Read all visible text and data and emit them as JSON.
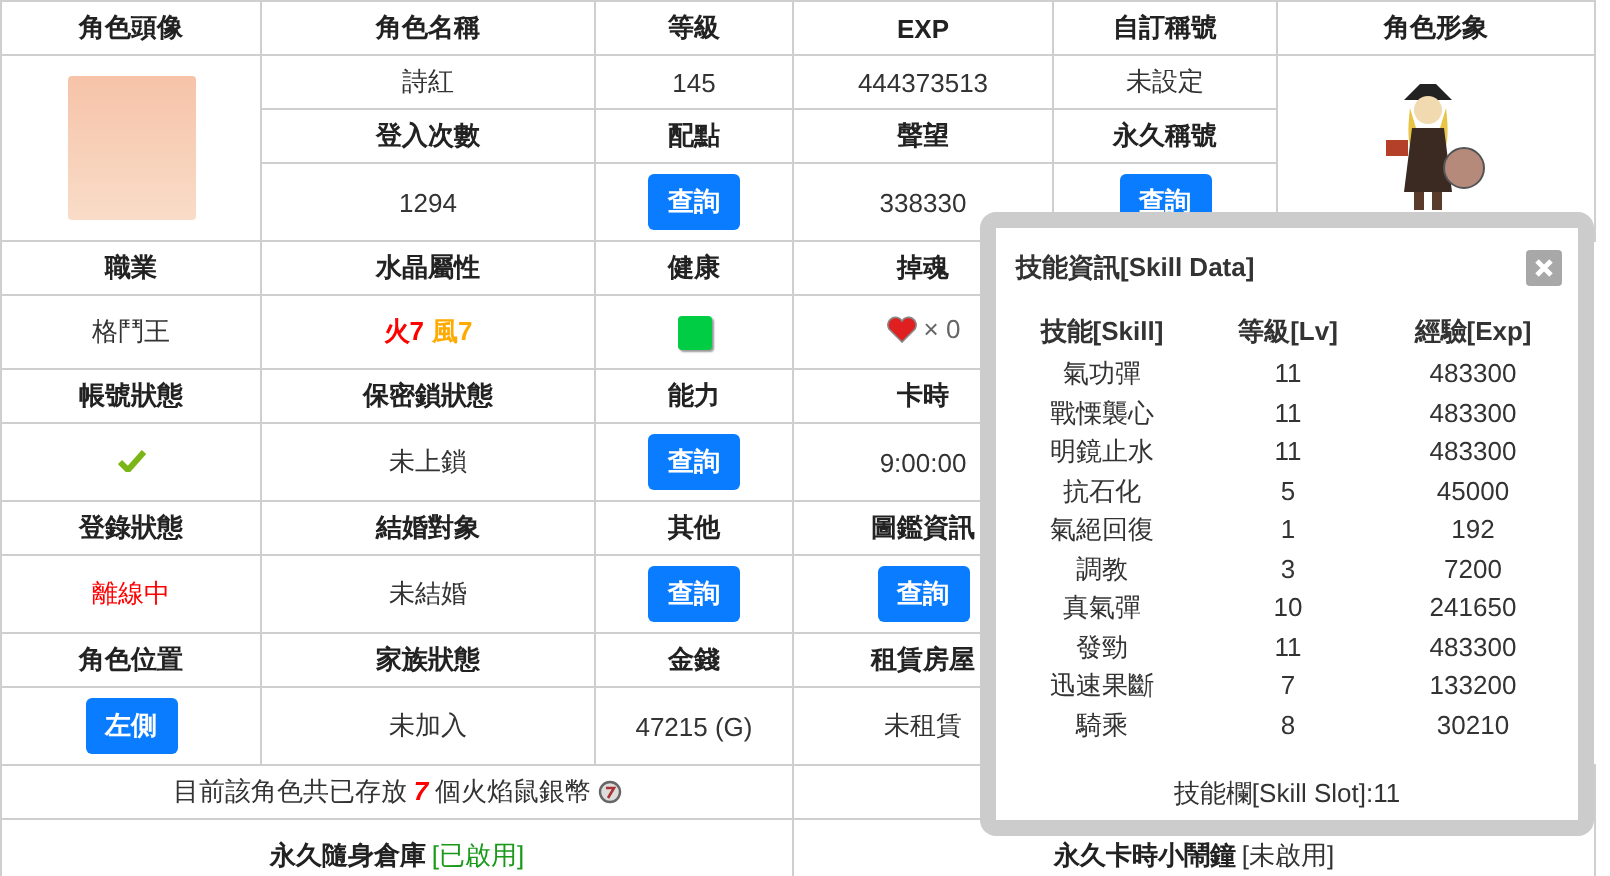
{
  "table": {
    "rows": [
      {
        "cells": [
          {
            "kind": "header",
            "text": "角色頭像"
          },
          {
            "kind": "header",
            "text": "角色名稱"
          },
          {
            "kind": "header",
            "text": "等級"
          },
          {
            "kind": "header",
            "text": "EXP"
          },
          {
            "kind": "header",
            "text": "自訂稱號"
          },
          {
            "kind": "header",
            "text": "角色形象"
          }
        ]
      },
      {
        "cells": [
          {
            "kind": "avatar"
          },
          {
            "kind": "text",
            "text": "詩紅"
          },
          {
            "kind": "text",
            "text": "145"
          },
          {
            "kind": "text",
            "text": "444373513"
          },
          {
            "kind": "text",
            "text": "未設定"
          },
          {
            "kind": "sprite"
          }
        ]
      },
      {
        "cells": [
          {
            "kind": "header",
            "text": "登入次數"
          },
          {
            "kind": "header",
            "text": "配點"
          },
          {
            "kind": "header",
            "text": "聲望"
          },
          {
            "kind": "header",
            "text": "永久稱號"
          }
        ]
      },
      {
        "cells": [
          {
            "kind": "text",
            "text": "1294"
          },
          {
            "kind": "button",
            "text": "查詢"
          },
          {
            "kind": "text",
            "text": "338330"
          },
          {
            "kind": "button",
            "text": "查詢"
          }
        ]
      },
      {
        "cells": [
          {
            "kind": "header",
            "text": "職業"
          },
          {
            "kind": "header",
            "text": "水晶屬性"
          },
          {
            "kind": "header",
            "text": "健康"
          },
          {
            "kind": "header",
            "text": "掉魂"
          }
        ]
      },
      {
        "cells": [
          {
            "kind": "text",
            "text": "格鬥王"
          },
          {
            "kind": "attributes",
            "items": [
              {
                "text": "火7",
                "color": "#ff0000"
              },
              {
                "text": "風7",
                "color": "#ffaa00"
              }
            ]
          },
          {
            "kind": "health",
            "ok": true
          },
          {
            "kind": "hearts",
            "text": "× 0"
          }
        ]
      },
      {
        "cells": [
          {
            "kind": "header",
            "text": "帳號狀態"
          },
          {
            "kind": "header",
            "text": "保密鎖狀態"
          },
          {
            "kind": "header",
            "text": "能力"
          },
          {
            "kind": "header",
            "text": "卡時"
          }
        ]
      },
      {
        "cells": [
          {
            "kind": "check",
            "ok": true
          },
          {
            "kind": "text",
            "text": "未上鎖"
          },
          {
            "kind": "button",
            "text": "查詢"
          },
          {
            "kind": "text",
            "text": "9:00:00"
          }
        ]
      },
      {
        "cells": [
          {
            "kind": "header",
            "text": "登錄狀態"
          },
          {
            "kind": "header",
            "text": "結婚對象"
          },
          {
            "kind": "header",
            "text": "其他"
          },
          {
            "kind": "header",
            "text": "圖鑑資訊"
          }
        ]
      },
      {
        "cells": [
          {
            "kind": "alert",
            "text": "離線中"
          },
          {
            "kind": "text",
            "text": "未結婚"
          },
          {
            "kind": "button",
            "text": "查詢"
          },
          {
            "kind": "button",
            "text": "查詢"
          }
        ]
      },
      {
        "cells": [
          {
            "kind": "header",
            "text": "角色位置"
          },
          {
            "kind": "header",
            "text": "家族狀態"
          },
          {
            "kind": "header",
            "text": "金錢"
          },
          {
            "kind": "header",
            "text": "租賃房屋"
          }
        ]
      },
      {
        "cells": [
          {
            "kind": "button",
            "text": "左側"
          },
          {
            "kind": "text",
            "text": "未加入"
          },
          {
            "kind": "text",
            "text": "47215 (G)"
          },
          {
            "kind": "text",
            "text": "未租賃"
          }
        ]
      }
    ]
  },
  "coin_note": "目前該角色共已存放 **7** 個火焰鼠銀幣",
  "storage": [
    {
      "name": "永久隨身倉庫",
      "status": "[已啟用]",
      "enabled": true
    },
    {
      "name": "永久卡時小鬧鐘",
      "status": "[未啟用]",
      "enabled": false
    }
  ],
  "skill_dialog": {
    "title": "技能資訊[Skill Data]",
    "columns": [
      "技能[Skill]",
      "等級[Lv]",
      "經驗[Exp]"
    ],
    "rows": [
      [
        "氣功彈",
        "11",
        "483300"
      ],
      [
        "戰慄襲心",
        "11",
        "483300"
      ],
      [
        "明鏡止水",
        "11",
        "483300"
      ],
      [
        "抗石化",
        "5",
        "45000"
      ],
      [
        "氣絕回復",
        "1",
        "192"
      ],
      [
        "調教",
        "3",
        "7200"
      ],
      [
        "真氣彈",
        "10",
        "241650"
      ],
      [
        "發勁",
        "11",
        "483300"
      ],
      [
        "迅速果斷",
        "7",
        "133200"
      ],
      [
        "騎乘",
        "8",
        "30210"
      ]
    ],
    "footer": "技能欄[Skill Slot]:11"
  }
}
